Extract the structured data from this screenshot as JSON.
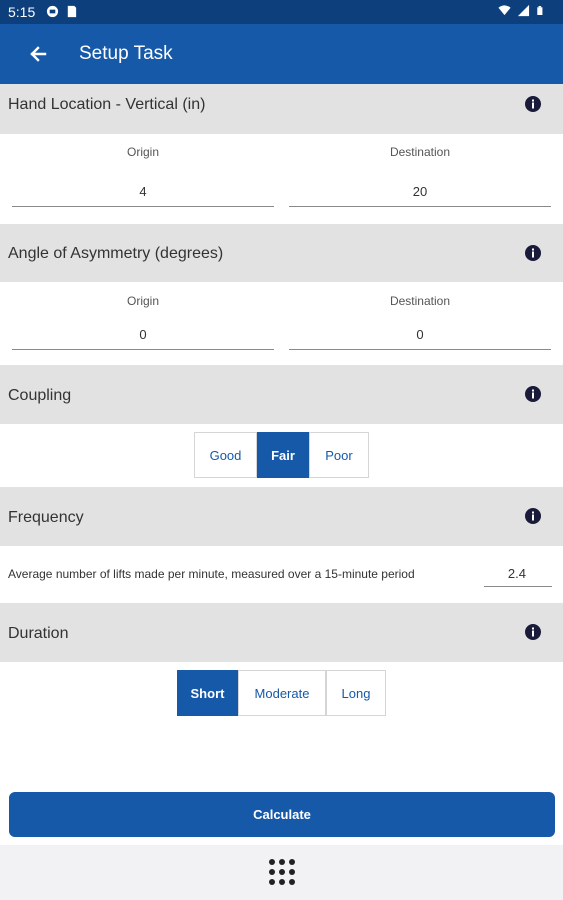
{
  "status_bar": {
    "time": "5:15"
  },
  "app_bar": {
    "title": "Setup Task"
  },
  "sections": {
    "hand_location": {
      "title": "Hand Location - Vertical (in)",
      "origin_label": "Origin",
      "destination_label": "Destination",
      "origin_value": "4",
      "destination_value": "20"
    },
    "asymmetry": {
      "title": "Angle of Asymmetry (degrees)",
      "origin_label": "Origin",
      "destination_label": "Destination",
      "origin_value": "0",
      "destination_value": "0"
    },
    "coupling": {
      "title": "Coupling",
      "options": [
        "Good",
        "Fair",
        "Poor"
      ],
      "selected": "Fair"
    },
    "frequency": {
      "title": "Frequency",
      "description": "Average number of lifts made per minute, measured over a 15-minute period",
      "value": "2.4"
    },
    "duration": {
      "title": "Duration",
      "options": [
        "Short",
        "Moderate",
        "Long"
      ],
      "selected": "Short"
    }
  },
  "calculate_label": "Calculate",
  "colors": {
    "primary": "#1659a8",
    "status_bar": "#0d3f7d",
    "section_header": "#e2e2e2",
    "info_icon": "#1a1a3a"
  },
  "icons": {
    "back": "arrow-left-icon",
    "info": "info-icon",
    "apps": "apps-grid-icon"
  }
}
